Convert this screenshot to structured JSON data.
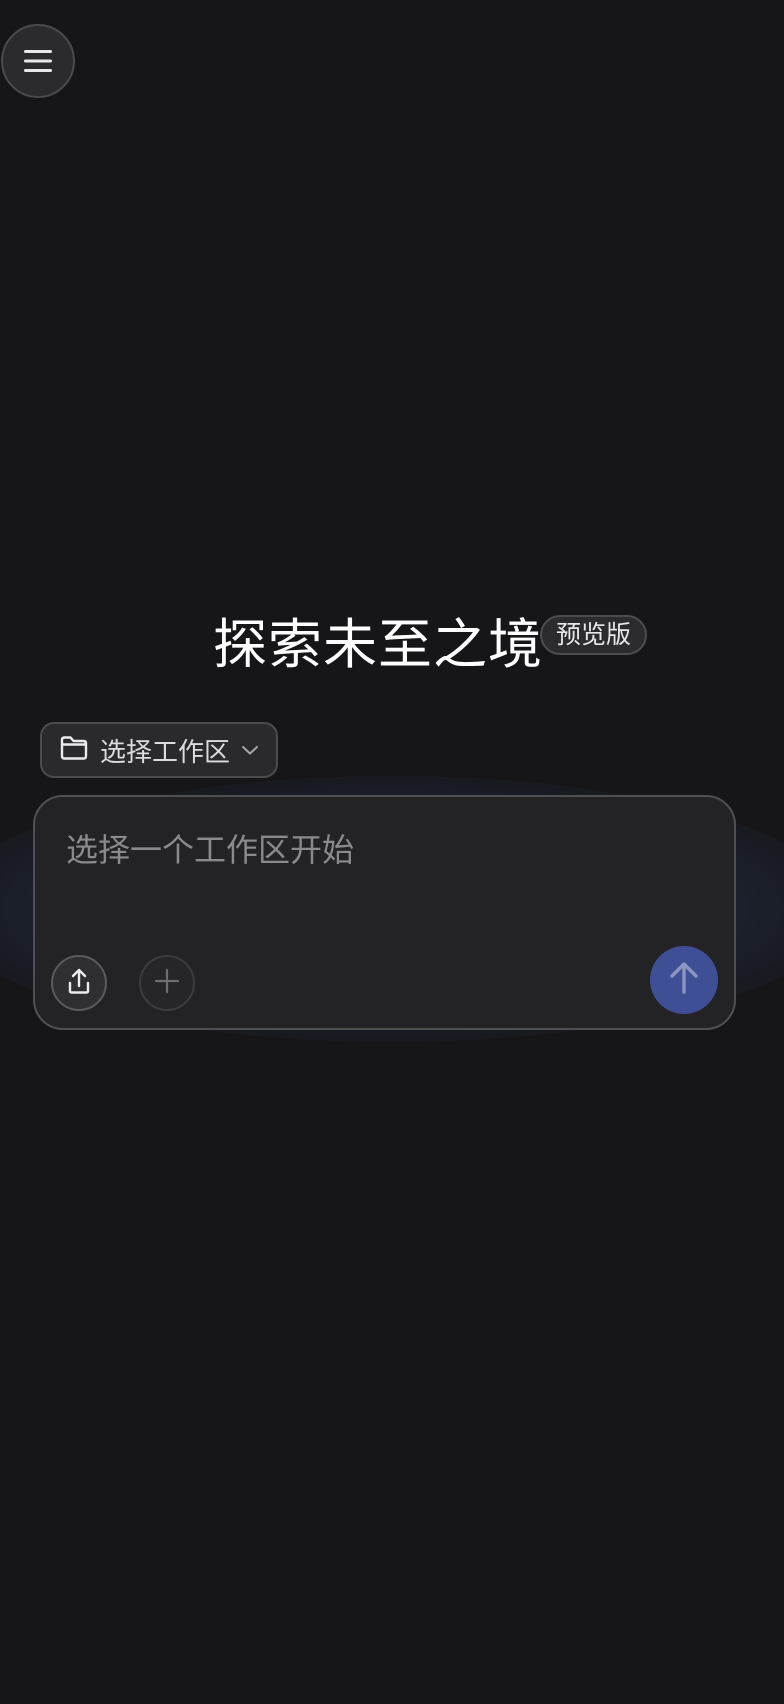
{
  "header": {
    "menu_icon": "hamburger-menu-icon"
  },
  "hero": {
    "title": "探索未至之境",
    "badge": "预览版"
  },
  "workspace": {
    "select_label": "选择工作区",
    "folder_icon": "folder-icon",
    "chevron_icon": "chevron-down-icon"
  },
  "composer": {
    "placeholder": "选择一个工作区开始",
    "value": "",
    "upload_icon": "upload-icon",
    "add_icon": "plus-icon",
    "send_icon": "arrow-up-icon"
  },
  "colors": {
    "background": "#161618",
    "send_button": "#3e4f96",
    "title_text": "#ffffff",
    "placeholder_text": "#8a8a8e"
  }
}
